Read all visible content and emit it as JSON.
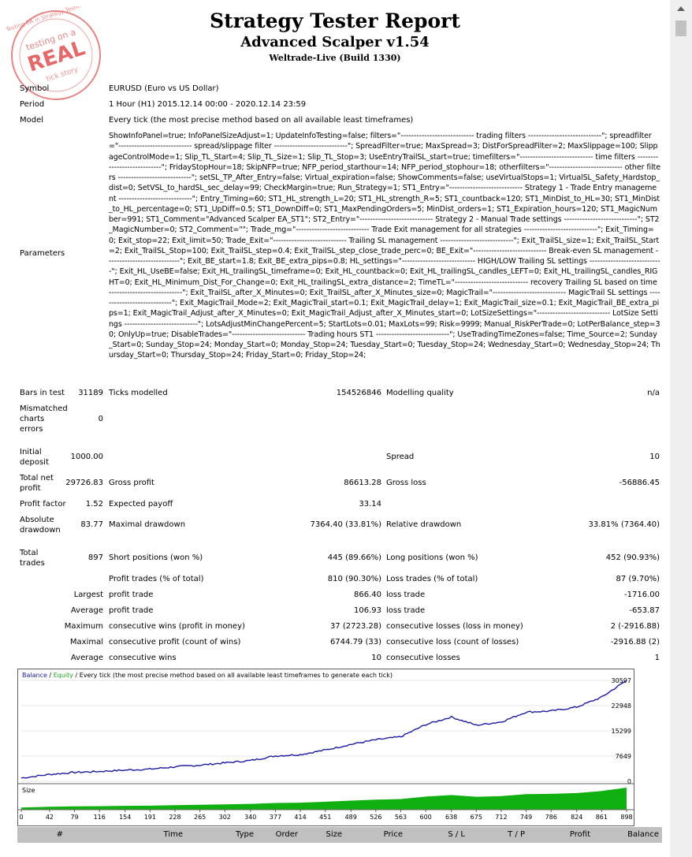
{
  "header": {
    "title": "Strategy Tester Report",
    "expert": "Advanced Scalper v1.54",
    "server": "Weltrade-Live (Build 1330)"
  },
  "stamp": {
    "text_top": "Testing EA in Strategy Tester",
    "text_mid": "testing on a",
    "text_main": "REAL",
    "text_bottom": "tick story"
  },
  "info": {
    "symbol_label": "Symbol",
    "symbol_value": "EURUSD (Euro vs US Dollar)",
    "period_label": "Period",
    "period_value": "1 Hour (H1) 2015.12.14 00:00 - 2020.12.14 23:59",
    "model_label": "Model",
    "model_value": "Every tick (the most precise method based on all available least timeframes)",
    "parameters_label": "Parameters",
    "parameters_value": "ShowInfoPanel=true; InfoPanelSizeAdjust=1; UpdateInfoTesting=false; filters=\"---------------------------- trading filters ----------------------------\"; spreadfilter=\"---------------------------- spread/slippage filter ----------------------------\"; SpreadFilter=true; MaxSpread=3; DistForSpreadFilter=2; MaxSlippage=100; SlippageControlMode=1; Slip_TL_Start=4; Slip_TL_Size=1; Slip_TL_Stop=3; UseEntryTrailSL_start=true; timefilters=\"---------------------------- time filters ----------------------------\"; FridayStopHour=18; SkipNFP=true; NFP_period_starthour=14; NFP_period_stophour=18; otherfilters=\"---------------------------- other filters ----------------------------\"; setSL_TP_After_Entry=false; Virtual_expiration=false; ShowComments=false; useVirtualStops=1; VirtualSL_Safety_Hardstop_dist=0; SetVSL_to_hardSL_sec_delay=99; CheckMargin=true; Run_Strategy=1; ST1_Entry=\"---------------------------- Strategy 1 - Trade Entry management ----------------------------\"; Entry_Timing=60; ST1_HL_strength_L=20; ST1_HL_strength_R=5; ST1_countback=120; ST1_MinDist_to_HL=30; ST1_MinDist_to_HL_percentage=0; ST1_UpDiff=0.5; ST1_DownDiff=0; ST1_MaxPendingOrders=5; MinDist_orders=1; ST1_Expiration_hours=120; ST1_MagicNumber=991; ST1_Comment=\"Advanced Scalper EA_ST1\"; ST2_Entry=\"---------------------------- Strategy 2 - Manual Trade settings ----------------------------\"; ST2_MagicNumber=0; ST2_Comment=\"\"; Trade_mg=\"---------------------------- Trade Exit management for all strategies ----------------------------\"; Exit_Timing=0; Exit_stop=22; Exit_limit=50; Trade_Exit=\"---------------------------- Trailing SL management ----------------------------\"; Exit_TrailSL_size=1; Exit_TrailSL_Start=2; Exit_TrailSL_Stop=100; Exit_TrailSL_step=0.4; Exit_TrailSL_step_close_trade_perc=0; BE_Exit=\"---------------------------- Break-even SL management ----------------------------\"; Exit_BE_start=1.8; Exit_BE_extra_pips=0.8; HL_settings=\"---------------------------- HIGH/LOW Trailing SL settings ----------------------------\"; Exit_HL_UseBE=false; Exit_HL_trailingSL_timeframe=0; Exit_HL_countback=0; Exit_HL_trailingSL_candles_LEFT=0; Exit_HL_trailingSL_candles_RIGHT=0; Exit_HL_Minimum_Dist_For_Change=0; Exit_HL_trailingSL_extra_distance=2; TimeTL=\"---------------------------- recovery Trailing SL based on time ----------------------------\"; Exit_TrailSL_after_X_Minutes=0; Exit_TrailSL_after_X_Minutes_size=0; MagicTrail=\"---------------------------- MagicTrail SL settings ----------------------------\"; Exit_MagicTrail_Mode=2; Exit_MagicTrail_start=0.1; Exit_MagicTrail_delay=1; Exit_MagicTrail_size=0.1; Exit_MagicTrail_BE_extra_pips=1; Exit_MagicTrail_Adjust_after_X_Minutes=0; Exit_MagicTrail_Adjust_after_X_Minutes_start=0; LotSizeSettings=\"---------------------------- LotSize Settings ----------------------------\"; LotsAdjustMinChangePercent=5; StartLots=0.01; MaxLots=99; Risk=9999; Manual_RiskPerTrade=0; LotPerBalance_step=30; OnlyUp=true; DisableTrades=\"---------------------------- Trading hours ST1 ----------------------------\"; UseTradingTimeZones=false; Time_Source=2; Sunday_Start=0; Sunday_Stop=24; Monday_Start=0; Monday_Stop=24; Tuesday_Start=0; Tuesday_Stop=24; Wednesday_Start=0; Wednesday_Stop=24; Thursday_Start=0; Thursday_Stop=24; Friday_Start=0; Friday_Stop=24;"
  },
  "stats": {
    "bars_label": "Bars in test",
    "bars_value": "31189",
    "ticks_label": "Ticks modelled",
    "ticks_value": "154526846",
    "quality_label": "Modelling quality",
    "quality_value": "n/a",
    "mismatch_label1": "Mismatched",
    "mismatch_label2": "charts",
    "mismatch_label3": "errors",
    "mismatch_value": "0",
    "deposit_label1": "Initial",
    "deposit_label2": "deposit",
    "deposit_value": "1000.00",
    "spread_label": "Spread",
    "spread_value": "10",
    "netprofit_label1": "Total net",
    "netprofit_label2": "profit",
    "netprofit_value": "29726.83",
    "grossprofit_label": "Gross profit",
    "grossprofit_value": "86613.28",
    "grossloss_label": "Gross loss",
    "grossloss_value": "-56886.45",
    "pf_label": "Profit factor",
    "pf_value": "1.52",
    "payoff_label": "Expected payoff",
    "payoff_value": "33.14",
    "absdd_label1": "Absolute",
    "absdd_label2": "drawdown",
    "absdd_value": "83.77",
    "maxdd_label": "Maximal drawdown",
    "maxdd_value": "7364.40 (33.81%)",
    "reldd_label": "Relative drawdown",
    "reldd_value": "33.81% (7364.40)",
    "trades_label1": "Total",
    "trades_label2": "trades",
    "trades_value": "897",
    "short_label": "Short positions (won %)",
    "short_value": "445 (89.66%)",
    "long_label": "Long positions (won %)",
    "long_value": "452 (90.93%)",
    "profittrades_label": "Profit trades (% of total)",
    "profittrades_value": "810 (90.30%)",
    "losstrades_label": "Loss trades (% of total)",
    "losstrades_value": "87 (9.70%)",
    "largest_label": "Largest",
    "largest_profit_label": "profit trade",
    "largest_profit_value": "866.40",
    "largest_loss_label": "loss trade",
    "largest_loss_value": "-1716.00",
    "average_label": "Average",
    "average_profit_label": "profit trade",
    "average_profit_value": "106.93",
    "average_loss_label": "loss trade",
    "average_loss_value": "-653.87",
    "maximum_label": "Maximum",
    "max_wins_label": "consecutive wins (profit in money)",
    "max_wins_value": "37 (2723.28)",
    "max_losses_label": "consecutive losses (loss in money)",
    "max_losses_value": "2 (-2916.88)",
    "maximal_label": "Maximal",
    "maximal_profit_label": "consecutive profit (count of wins)",
    "maximal_profit_value": "6744.79 (33)",
    "maximal_loss_label": "consecutive loss (count of losses)",
    "maximal_loss_value": "-2916.88 (2)",
    "avg2_label": "Average",
    "avg_wins_label": "consecutive wins",
    "avg_wins_value": "10",
    "avg_losses_label": "consecutive losses",
    "avg_losses_value": "1"
  },
  "chart": {
    "legend_balance": "Balance",
    "legend_sep": " / ",
    "legend_equity": "Equity",
    "legend_rest": " / Every tick (the most precise method based on all available least timeframes to generate each tick)",
    "size_label": "Size",
    "colors": {
      "balance": "#1a1aa0",
      "equity": "#20a020",
      "size": "#10b010"
    }
  },
  "chart_data": {
    "type": "line",
    "title": "",
    "y_ticks": [
      "30597",
      "22948",
      "15299",
      "7649",
      "0"
    ],
    "x_ticks": [
      "0",
      "42",
      "79",
      "116",
      "154",
      "191",
      "228",
      "265",
      "302",
      "340",
      "377",
      "414",
      "451",
      "489",
      "526",
      "563",
      "600",
      "638",
      "675",
      "712",
      "749",
      "786",
      "824",
      "861",
      "898"
    ],
    "ylim": [
      0,
      30597
    ],
    "xlim": [
      0,
      898
    ],
    "series": [
      {
        "name": "Balance",
        "x": [
          0,
          42,
          79,
          116,
          154,
          191,
          228,
          265,
          302,
          340,
          377,
          414,
          451,
          489,
          526,
          563,
          600,
          638,
          675,
          712,
          749,
          786,
          824,
          861,
          898
        ],
        "values": [
          1000,
          2100,
          2700,
          3000,
          3400,
          3700,
          4400,
          4900,
          5600,
          6300,
          7700,
          8100,
          9500,
          11200,
          12600,
          13500,
          17200,
          19500,
          17000,
          18000,
          21000,
          21300,
          22500,
          25500,
          30597
        ]
      }
    ]
  },
  "table": {
    "headers": [
      "#",
      "Time",
      "Type",
      "Order",
      "Size",
      "Price",
      "S / L",
      "T / P",
      "Profit",
      "Balance"
    ]
  }
}
